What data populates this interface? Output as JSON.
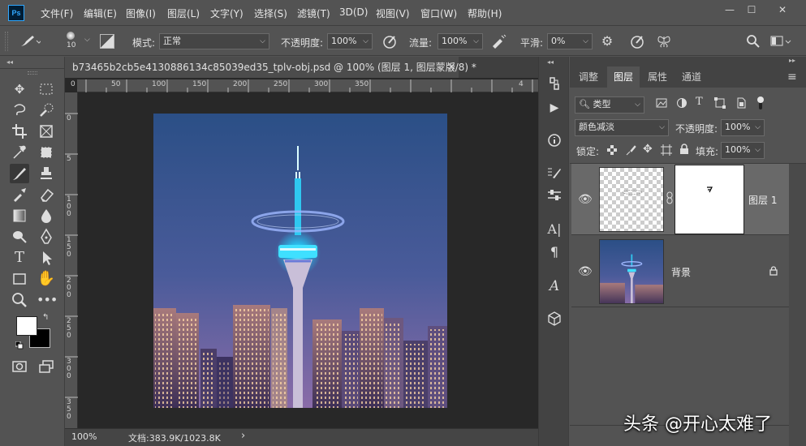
{
  "app": {
    "logo": "Ps",
    "menus": [
      "文件(F)",
      "编辑(E)",
      "图像(I)",
      "图层(L)",
      "文字(Y)",
      "选择(S)",
      "滤镜(T)",
      "3D(D)",
      "视图(V)",
      "窗口(W)",
      "帮助(H)"
    ],
    "window_buttons": [
      "—",
      "☐",
      "✕"
    ]
  },
  "options_bar": {
    "brush_size": "10",
    "mode_label": "模式:",
    "mode_value": "正常",
    "opacity_label": "不透明度:",
    "opacity_value": "100%",
    "flow_label": "流量:",
    "flow_value": "100%",
    "smoothing_label": "平滑:",
    "smoothing_value": "0%"
  },
  "document": {
    "tab_title": "b73465b2cb5e4130886134c85039ed35_tplv-obj.psd @ 100% (图层 1, 图层蒙版/8) *",
    "tab_close": "×",
    "ruler_h": [
      "0",
      "50",
      "100",
      "150",
      "200",
      "250",
      "300",
      "350",
      "4"
    ],
    "ruler_v": [
      "0",
      "5",
      "1\n0\n0",
      "1\n5\n0",
      "2\n0\n0",
      "2\n5\n0",
      "3\n0\n0",
      "3\n5\n0"
    ],
    "zoom": "100%",
    "doc_info": "文档:383.9K/1023.8K",
    "status_arrow": "›"
  },
  "panel": {
    "tabs": [
      "调整",
      "图层",
      "属性",
      "通道"
    ],
    "active_tab": "图层",
    "filter_kind": "类型",
    "blend_mode": "颜色减淡",
    "opacity_label": "不透明度:",
    "opacity_value": "100%",
    "lock_label": "锁定:",
    "fill_label": "填充:",
    "fill_value": "100%",
    "layers": [
      {
        "name": "图层 1",
        "selected": true
      },
      {
        "name": "背景",
        "selected": false
      }
    ]
  },
  "watermark": "头条 @开心太难了",
  "colors": {
    "bg": "#535353",
    "canvas_bg": "#282828",
    "panel_selected": "#696969",
    "ps_blue": "#31a8ff"
  }
}
